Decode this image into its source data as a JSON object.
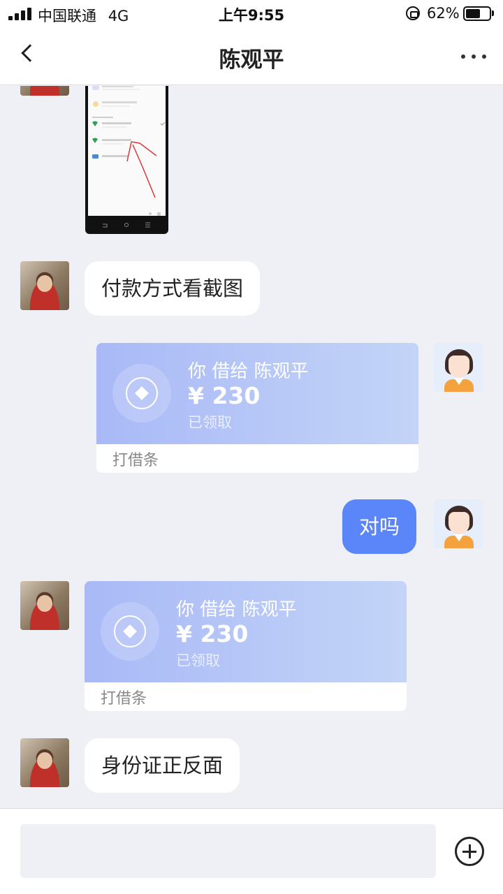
{
  "status_bar": {
    "carrier": "中国联通",
    "network": "4G",
    "time": "上午9:55",
    "battery": "62%",
    "battery_level": 0.62
  },
  "navbar": {
    "back_icon": "back-chevron-icon",
    "title": "陈观平",
    "more_icon": "more-dots-icon"
  },
  "messages": [
    {
      "type": "image",
      "from": "other",
      "icon": "payment-screenshot-image"
    },
    {
      "type": "text",
      "from": "other",
      "text": "付款方式看截图"
    },
    {
      "type": "loan",
      "from": "me",
      "line1": "你 借给 陈观平",
      "amount": "¥ 230",
      "status": "已领取",
      "action": "打借条"
    },
    {
      "type": "text",
      "from": "me",
      "text": "对吗"
    },
    {
      "type": "loan",
      "from": "other",
      "line1": "你 借给 陈观平",
      "amount": "¥ 230",
      "status": "已领取",
      "action": "打借条"
    },
    {
      "type": "text",
      "from": "other",
      "text": "身份证正反面"
    }
  ],
  "input_bar": {
    "placeholder": "",
    "plus_icon": "plus-circle-icon"
  },
  "colors": {
    "background": "#eef0f5",
    "outgoing_bubble": "#5b86f9",
    "loan_card_start": "#a9b9f7",
    "loan_card_end": "#c3d4f7"
  }
}
